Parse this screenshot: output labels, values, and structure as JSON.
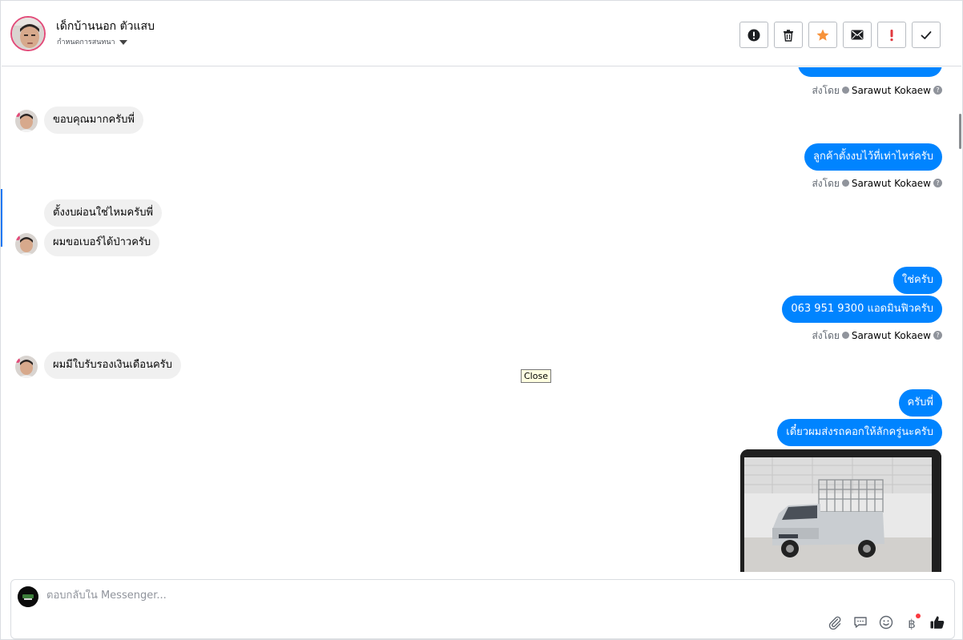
{
  "header": {
    "contact_name": "เด็กบ้านนอก ตัวแสบ",
    "subtitle": "กำหนดการสนทนา",
    "buttons": [
      {
        "icon": "alert-circle-icon"
      },
      {
        "icon": "trash-icon"
      },
      {
        "icon": "star-icon",
        "color": "#f7923a"
      },
      {
        "icon": "envelope-icon"
      },
      {
        "icon": "exclamation-icon",
        "color": "#e0383e"
      },
      {
        "icon": "checkmark-icon"
      }
    ]
  },
  "messages": {
    "m1": "ขอบคุณมากครับพี่",
    "m2": "ลูกค้าตั้งงบไว้ที่เท่าไหร่ครับ",
    "m3": "ตั้งงบผ่อนใช่ไหมครับพี่",
    "m4": "ผมขอเบอร์ได้ป่าวครับ",
    "m5": "ใช่ครับ",
    "m6": "063 951 9300 แอดมินฟิวครับ",
    "m7": "ผมมีใบรับรองเงินเดือนครับ",
    "m8": "ครับพี่",
    "m9": "เดี๋ยวผมส่งรถคอกให้ลักครู่นะครับ"
  },
  "sent_by": {
    "prefix": "ส่งโดย",
    "name": "Sarawut Kokaew",
    "help": "?"
  },
  "tooltip": "Close",
  "composer": {
    "placeholder": "ตอบกลับใน Messenger...",
    "icons": [
      "paperclip-icon",
      "chat-bubble-icon",
      "emoji-icon",
      "baht-icon",
      "thumbs-up-icon"
    ],
    "baht_symbol": "฿"
  },
  "colors": {
    "outgoing_bubble": "#0084ff",
    "incoming_bubble": "#f0f0f0",
    "accent": "#1877f2"
  }
}
